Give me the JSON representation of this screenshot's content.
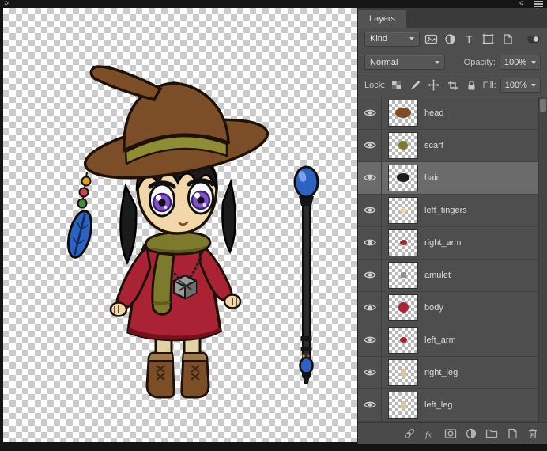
{
  "window": {
    "left_collapse_icon": "»",
    "panel_collapse_icon": "«"
  },
  "layers_panel": {
    "tab_label": "Layers",
    "kind_value": "Kind",
    "blend_mode_value": "Normal",
    "opacity_label": "Opacity:",
    "opacity_value": "100%",
    "lock_label": "Lock:",
    "fill_label": "Fill:",
    "fill_value": "100%",
    "fx_label": "fx",
    "type_filter_glyph": "T",
    "layers": [
      {
        "name": "head",
        "selected": false,
        "thumb": {
          "color": "#7b4e27",
          "w": 20,
          "h": 13,
          "round": true
        }
      },
      {
        "name": "scarf",
        "selected": false,
        "thumb": {
          "color": "#7c7a2d",
          "w": 12,
          "h": 11,
          "round": true
        }
      },
      {
        "name": "hair",
        "selected": true,
        "thumb": {
          "color": "#1c1c1c",
          "w": 16,
          "h": 11,
          "round": true
        }
      },
      {
        "name": "left_fingers",
        "selected": false,
        "thumb": {
          "color": "#f2d7a8",
          "w": 8,
          "h": 6,
          "round": true
        }
      },
      {
        "name": "right_arm",
        "selected": false,
        "thumb": {
          "color": "#a92334",
          "w": 9,
          "h": 7,
          "round": true
        }
      },
      {
        "name": "amulet",
        "selected": false,
        "thumb": {
          "color": "#8f8f8f",
          "w": 7,
          "h": 7,
          "round": false
        }
      },
      {
        "name": "body",
        "selected": false,
        "thumb": {
          "color": "#a92334",
          "w": 13,
          "h": 13,
          "round": true
        }
      },
      {
        "name": "left_arm",
        "selected": false,
        "thumb": {
          "color": "#a92334",
          "w": 9,
          "h": 7,
          "round": true
        }
      },
      {
        "name": "right_leg",
        "selected": false,
        "thumb": {
          "color": "#d9c89c",
          "w": 7,
          "h": 10,
          "round": false
        }
      },
      {
        "name": "left_leg",
        "selected": false,
        "thumb": {
          "color": "#d9c89c",
          "w": 7,
          "h": 10,
          "round": false
        }
      }
    ]
  },
  "colors": {
    "panel_bg": "#4e4e4e",
    "selected_row_bg": "#6b6b6b",
    "dress_red": "#a92334",
    "hat_brown": "#7b4e27",
    "scarf_olive": "#7c7a2d",
    "eye_purple": "#8053c6",
    "orb_blue": "#2c62c2",
    "skin_tone": "#f2d7a8"
  }
}
